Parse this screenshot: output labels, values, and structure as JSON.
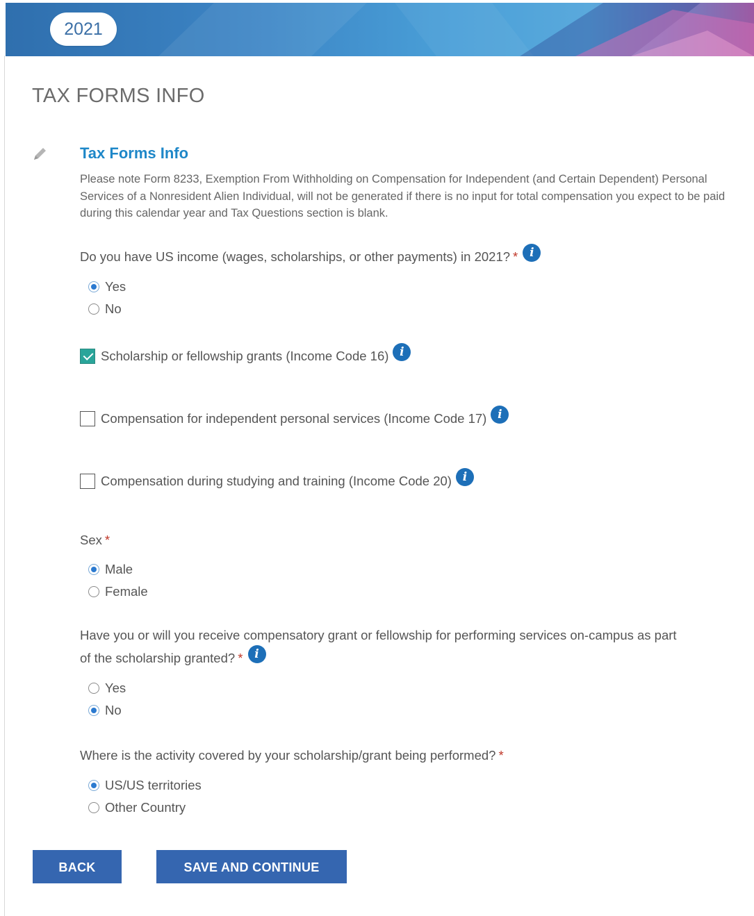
{
  "banner": {
    "year": "2021"
  },
  "page": {
    "title": "TAX FORMS INFO"
  },
  "section": {
    "title": "Tax Forms Info",
    "note": "Please note Form 8233, Exemption From Withholding on Compensation for Independent (and Certain Dependent) Personal Services of a Nonresident Alien Individual, will not be generated if there is no input for total compensation you expect to be paid during this calendar year and Tax Questions section is blank."
  },
  "q_income": {
    "label": "Do you have US income (wages, scholarships, or other payments) in 2021?",
    "required": "*",
    "options": [
      {
        "label": "Yes",
        "checked": true
      },
      {
        "label": "No",
        "checked": false
      }
    ]
  },
  "income_types": [
    {
      "label": "Scholarship or fellowship grants (Income Code 16)",
      "checked": true
    },
    {
      "label": "Compensation for independent personal services (Income Code 17)",
      "checked": false
    },
    {
      "label": "Compensation during studying and training (Income Code 20)",
      "checked": false
    }
  ],
  "q_sex": {
    "label": "Sex",
    "required": "*",
    "options": [
      {
        "label": "Male",
        "checked": true
      },
      {
        "label": "Female",
        "checked": false
      }
    ]
  },
  "q_comp_grant": {
    "label_line1": "Have you or will you receive compensatory grant or fellowship for performing services on-campus as part",
    "label_line2": "of the scholarship granted?",
    "required": "*",
    "options": [
      {
        "label": "Yes",
        "checked": false
      },
      {
        "label": "No",
        "checked": true
      }
    ]
  },
  "q_activity": {
    "label": "Where is the activity covered by your scholarship/grant being performed?",
    "required": "*",
    "options": [
      {
        "label": "US/US territories",
        "checked": true
      },
      {
        "label": "Other Country",
        "checked": false
      }
    ]
  },
  "info_glyph": "i",
  "buttons": {
    "back": "BACK",
    "save": "SAVE AND CONTINUE"
  },
  "colors": {
    "accent": "#1e87c8",
    "button": "#3566b0",
    "required": "#c0392b",
    "checkbox_checked": "#2aa59a"
  }
}
